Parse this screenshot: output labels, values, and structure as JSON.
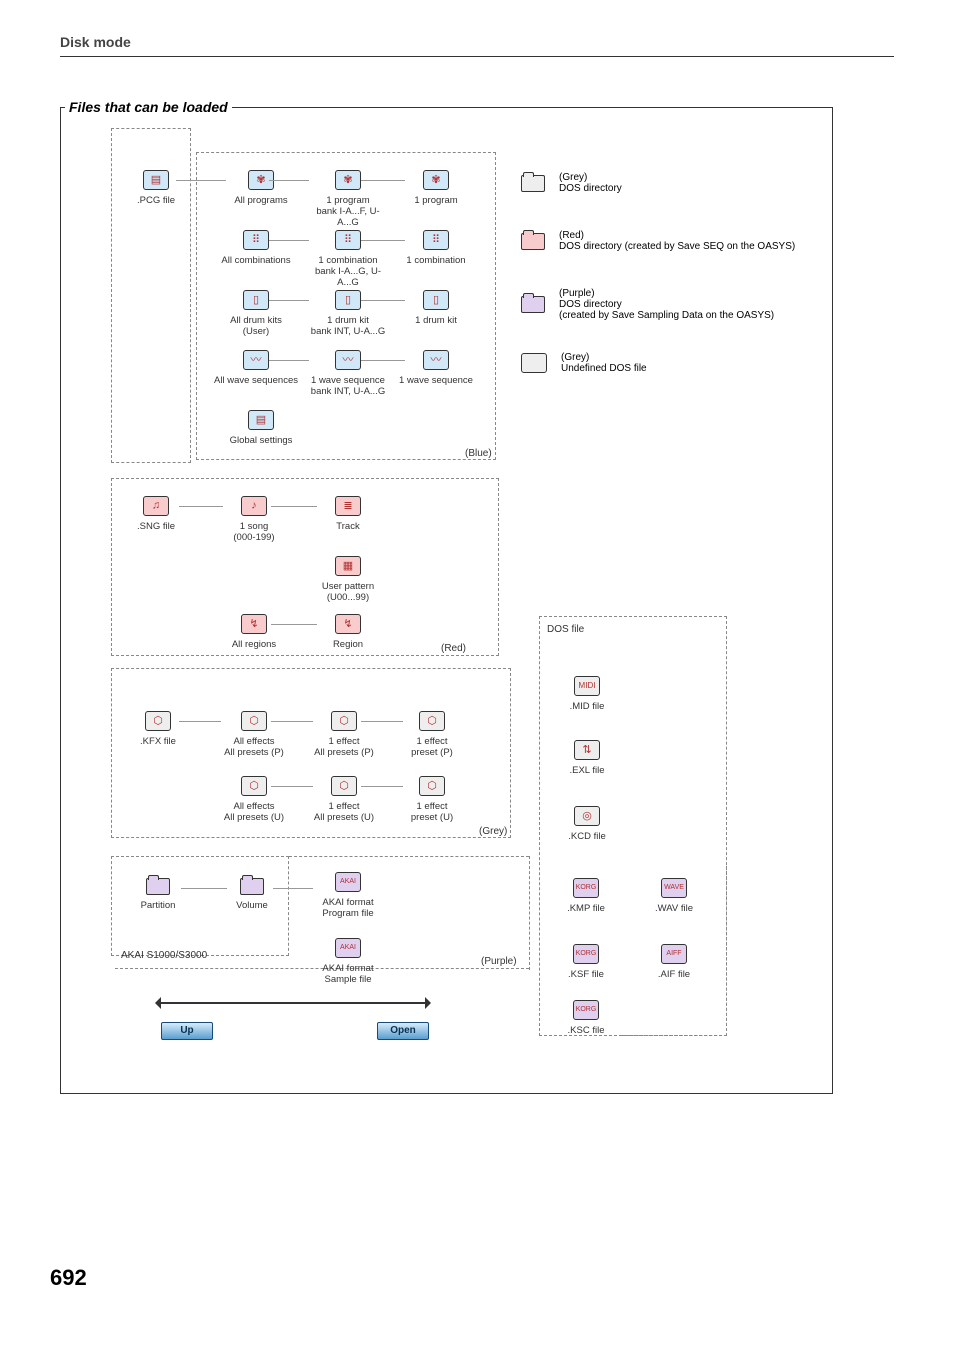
{
  "page": {
    "header": "Disk mode",
    "title": "Files that can be loaded",
    "page_number": "692"
  },
  "legend": {
    "grey1": {
      "color": "(Grey)",
      "label": "DOS directory"
    },
    "red": {
      "color": "(Red)",
      "label": "DOS directory (created by Save SEQ on the OASYS)"
    },
    "purple": {
      "color": "(Purple)",
      "label": "DOS directory\n(created by Save Sampling Data on the OASYS)"
    },
    "grey2": {
      "color": "(Grey)",
      "label": "Undefined DOS file"
    }
  },
  "groups": {
    "pcg": {
      "color_label": "(Blue)",
      "root": ".PCG file",
      "rows": [
        {
          "c1": "All programs",
          "c2": "1 program\nbank I-A...F, U-A...G",
          "c3": "1 program"
        },
        {
          "c1": "All combinations",
          "c2": "1 combination\nbank I-A...G, U-A...G",
          "c3": "1 combination"
        },
        {
          "c1": "All drum kits\n(User)",
          "c2": "1 drum kit\nbank INT, U-A...G",
          "c3": "1 drum kit"
        },
        {
          "c1": "All wave sequences",
          "c2": "1 wave sequence\nbank INT, U-A...G",
          "c3": "1 wave sequence"
        },
        {
          "c1": "Global settings"
        }
      ]
    },
    "sng": {
      "color_label": "(Red)",
      "root": ".SNG file",
      "r1c1": "1 song\n(000-199)",
      "r1c2": "Track",
      "r2c2": "User pattern\n(U00...99)",
      "r3c1": "All regions",
      "r3c2": "Region"
    },
    "kfx": {
      "color_label": "(Grey)",
      "root": ".KFX file",
      "r1c1": "All effects\nAll presets (P)",
      "r1c2": "1 effect\nAll presets (P)",
      "r1c3": "1 effect\npreset (P)",
      "r2c1": "All effects\nAll presets (U)",
      "r2c2": "1 effect\nAll presets (U)",
      "r2c3": "1 effect\npreset (U)"
    },
    "akai": {
      "color_label": "(Purple)",
      "section_label": "AKAI S1000/S3000",
      "root": "Partition",
      "c2": "Volume",
      "r1c3": "AKAI format\nProgram file",
      "r2c3": "AKAI format\nSample file"
    },
    "dos": {
      "title": "DOS file",
      "mid": ".MID file",
      "exl": ".EXL file",
      "kcd": ".KCD file",
      "kmp": ".KMP file",
      "wav": ".WAV file",
      "ksf": ".KSF file",
      "aif": ".AIF file",
      "ksc": ".KSC file"
    }
  },
  "buttons": {
    "up": "Up",
    "open": "Open"
  }
}
